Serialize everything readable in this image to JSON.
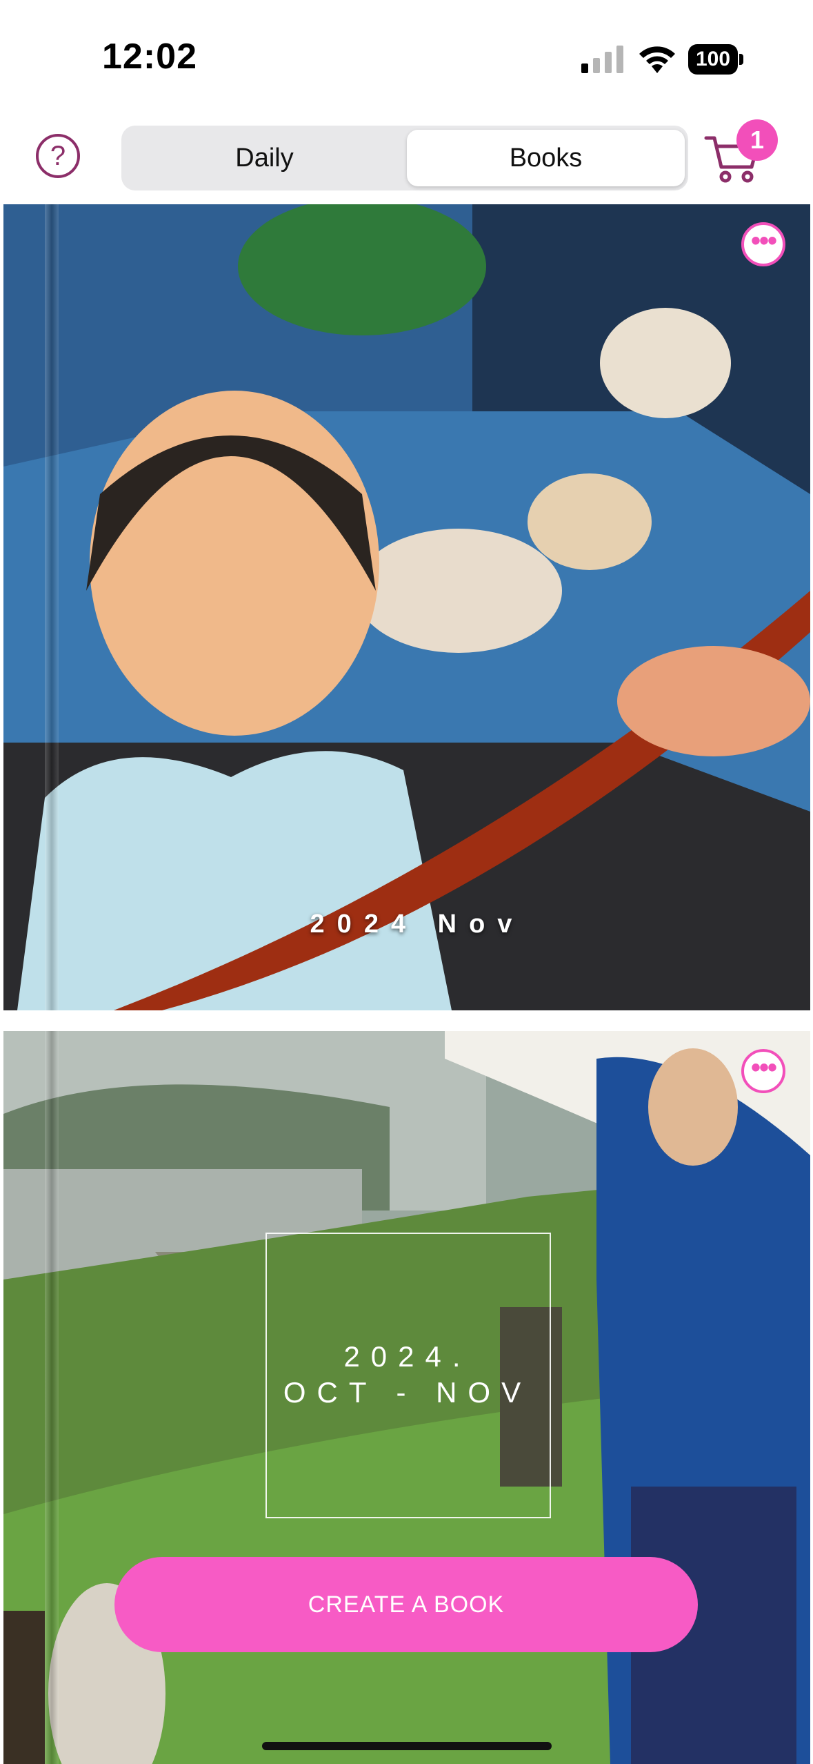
{
  "status_bar": {
    "time": "12:02",
    "battery": "100"
  },
  "header": {
    "help_icon": "question-mark-icon",
    "tabs": [
      {
        "label": "Daily",
        "selected": false
      },
      {
        "label": "Books",
        "selected": true
      }
    ],
    "cart_icon": "cart-icon",
    "cart_count": "1"
  },
  "books": [
    {
      "cover_title": "2024 Nov",
      "more_icon": "ellipsis-icon"
    },
    {
      "cover_year": "2024.",
      "cover_range": "OCT - NOV",
      "more_icon": "ellipsis-icon"
    }
  ],
  "colors": {
    "accent": "#f75bc5",
    "brand": "#8c2e69",
    "badge": "#f24fba"
  },
  "create_button": {
    "label": "CREATE A BOOK"
  }
}
